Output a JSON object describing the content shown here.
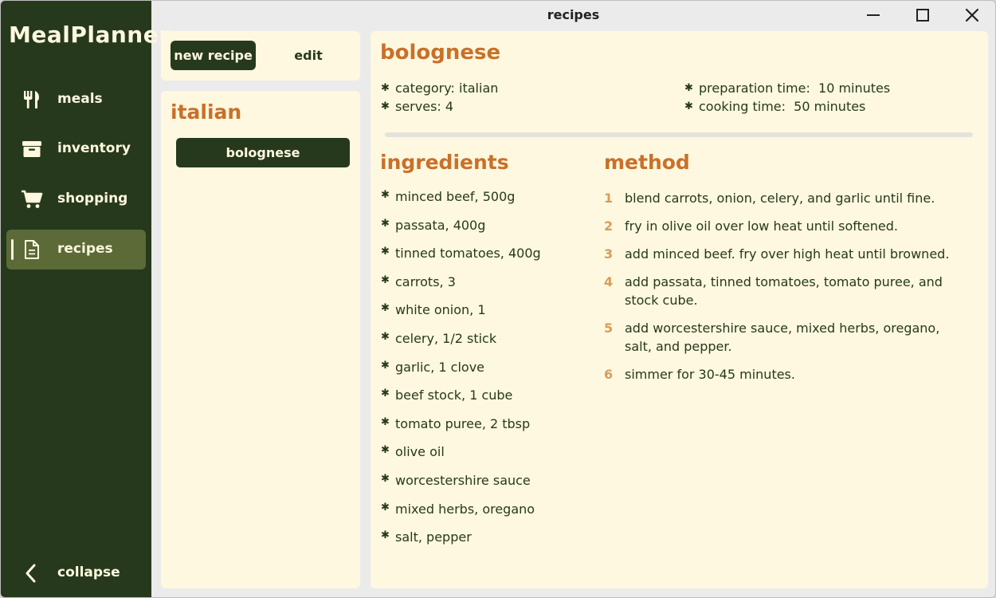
{
  "app": {
    "brand": "MealPlanner",
    "window_title": "recipes"
  },
  "colors": {
    "sidebar_bg": "#27391c",
    "sidebar_active": "#5b6a37",
    "panel_bg": "#fdf8df",
    "accent": "#c9702a",
    "text_dark": "#27391c"
  },
  "sidebar": {
    "items": [
      {
        "label": "meals",
        "icon": "fork-knife-icon"
      },
      {
        "label": "inventory",
        "icon": "archive-box-icon"
      },
      {
        "label": "shopping",
        "icon": "shopping-cart-icon"
      },
      {
        "label": "recipes",
        "icon": "document-icon",
        "active": true
      }
    ],
    "collapse_label": "collapse"
  },
  "toolbar": {
    "new_label": "new recipe",
    "edit_label": "edit"
  },
  "recipe_list": {
    "category": "italian",
    "items": [
      "bolognese"
    ]
  },
  "recipe": {
    "title": "bolognese",
    "category": "category: italian",
    "serves": "serves: 4",
    "prep_time": "preparation time:  10 minutes",
    "cook_time": "cooking time:  50 minutes",
    "ingredients_heading": "ingredients",
    "method_heading": "method",
    "ingredients": [
      "minced beef, 500g",
      "passata, 400g",
      "tinned tomatoes, 400g",
      "carrots, 3",
      "white onion, 1",
      "celery, 1/2 stick",
      "garlic, 1 clove",
      "beef stock, 1 cube",
      "tomato puree, 2 tbsp",
      "olive oil",
      "worcestershire sauce",
      "mixed herbs, oregano",
      "salt, pepper"
    ],
    "method": [
      {
        "num": "1",
        "text": "blend carrots, onion, celery, and garlic until fine."
      },
      {
        "num": "2",
        "text": "fry in olive oil over low heat until softened."
      },
      {
        "num": "3",
        "text": "add minced beef. fry over high heat until browned."
      },
      {
        "num": "4",
        "text": "add passata, tinned tomatoes, tomato puree, and stock cube."
      },
      {
        "num": "5",
        "text": "add worcestershire sauce, mixed herbs, oregano, salt, and pepper."
      },
      {
        "num": "6",
        "text": "simmer for 30-45 minutes."
      }
    ]
  }
}
